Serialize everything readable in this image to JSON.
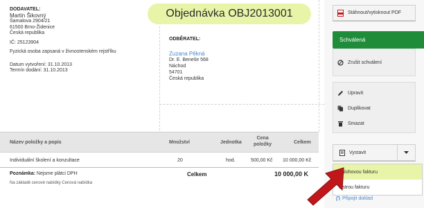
{
  "title": "Objednávka OBJ2013001",
  "supplier": {
    "label": "DODAVATEL:",
    "name": "Martin Šikovný",
    "street": "Šamalova 2904/21",
    "city": "61500 Brno-Židenice",
    "country": "Česká republika",
    "ico": "IČ: 25123904",
    "registry": "Fyzická osoba zapsaná v živnostenském rejstříku",
    "created": "Datum vytvoření: 31.10.2013",
    "due": "Termín dodání: 31.10.2013"
  },
  "customer": {
    "label": "ODBĚRATEL:",
    "name": "Zuzana Pěkná",
    "street": "Dr. E. Beneše 568",
    "city": "Náchod",
    "zip": "54701",
    "country": "Česká republika"
  },
  "table": {
    "headers": {
      "item": "Název položky a popis",
      "qty": "Množství",
      "unit": "Jednotka",
      "price_line1": "Cena",
      "price_line2": "položky",
      "total": "Celkem"
    },
    "rows": [
      {
        "item": "Individuální školení a konzultace",
        "qty": "20",
        "unit": "hod.",
        "price": "500,00 Kč",
        "total": "10 000,00 Kč"
      }
    ],
    "footer": {
      "note_label": "Poznámka:",
      "note_text": "Nejsme plátci DPH",
      "sub_note": "Na základě cenové nabídky Cenová nabídka",
      "total_label": "Celkem",
      "total_value": "10 000,00 K"
    }
  },
  "sidebar": {
    "pdf_label": "Stáhnout/vytisknout PDF",
    "status_label": "Schválená",
    "cancel_label": "Zrušit schválení",
    "edit_label": "Upravit",
    "duplicate_label": "Duplikovat",
    "delete_label": "Smazat",
    "issue_label": "Vystavit",
    "dropdown": [
      {
        "label": "Zálohovou fakturu"
      },
      {
        "label": "Ostrou fakturu"
      }
    ],
    "attach_label": "Připojit doklad"
  },
  "colors": {
    "accent_green": "#1f8c3a",
    "highlight": "#e8f5a8",
    "link_blue": "#4a87c8",
    "pointer_red": "#c0171b"
  }
}
